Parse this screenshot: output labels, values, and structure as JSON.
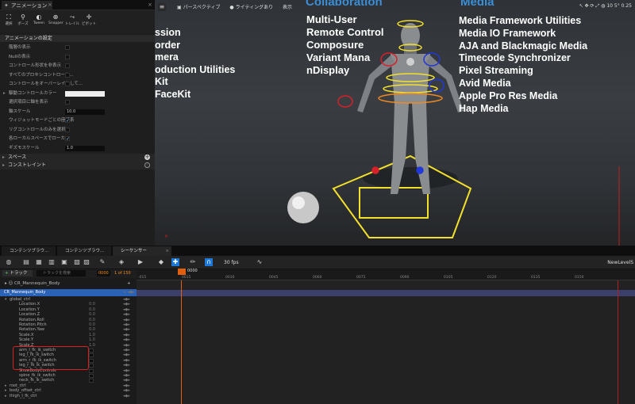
{
  "anim_panel": {
    "tab_label": "アニメーション",
    "tools": [
      "選択",
      "ポーズ",
      "Tween",
      "Snapper",
      "トレイル",
      "ピボット"
    ],
    "settings_title": "アニメーションの設定",
    "rows": [
      {
        "label": "階層の表示",
        "type": "check",
        "checked": false
      },
      {
        "label": "Nullの表示",
        "type": "check",
        "checked": false
      },
      {
        "label": "コントロール形状を非表示",
        "type": "check",
        "checked": false
      },
      {
        "label": "すべてのプロキシコントロール...",
        "type": "check",
        "checked": false
      },
      {
        "label": "コントロールをオーバーレイとして...",
        "type": "check",
        "checked": false
      },
      {
        "label": "駆動コントロールカラー",
        "type": "color"
      },
      {
        "label": "選択項目に軸を表示",
        "type": "check",
        "checked": false
      },
      {
        "label": "軸スケール",
        "type": "num",
        "value": "10.0"
      },
      {
        "label": "ウィジェットモードごとの座標系",
        "type": "check",
        "checked": true
      },
      {
        "label": "リグコントロールのみを選択",
        "type": "check",
        "checked": false
      },
      {
        "label": "各ローカルスペースでローカ...",
        "type": "check",
        "checked": true
      },
      {
        "label": "ギズモスケール",
        "type": "num",
        "value": "1.0"
      }
    ],
    "sections": [
      "スペース",
      "コンストレイント"
    ]
  },
  "viewport": {
    "toolbar": [
      "パースペクティブ",
      "ライティングあり",
      "表示"
    ],
    "right_vals": [
      "10",
      "5°",
      "0.25"
    ],
    "col1": [
      "ssion",
      "order",
      "mera",
      "oduction Utilities",
      "Kit",
      "FaceKit"
    ],
    "col2_head": "Collaboration",
    "col2": [
      "Multi-User",
      "Remote Control",
      "Composure",
      "Variant Mana",
      "nDisplay"
    ],
    "col3_head": "Media",
    "col3": [
      "Media Framework Utilities",
      "Media IO Framework",
      "AJA and Blackmagic Media",
      "Timecode Synchronizer",
      "Pixel Streaming",
      "Avid Media",
      "Apple Pro Res Media",
      "Hap Media"
    ]
  },
  "bottom_tabs": [
    "コンテンツブラウ...",
    "コンテンツブラウ...",
    "シーケンサー"
  ],
  "seq": {
    "fps": "30 fps",
    "level": "NewLevelS",
    "track_btn": "トラック",
    "search_ph": "トラックを検索",
    "frame": "0000",
    "frame_of": "1 of 150",
    "playhead": "0000",
    "ticks": [
      "-015",
      "0015",
      "0030",
      "0045",
      "0060",
      "0075",
      "0090",
      "0105",
      "0120",
      "0135",
      "0150"
    ],
    "root": "CR_Mannequin_Body",
    "rows": [
      {
        "t": "CR_Mannequin_Body",
        "sel": true,
        "d": 0
      },
      {
        "t": "global_ctrl",
        "d": 1
      },
      {
        "t": "Location.X",
        "v": "0.0",
        "d": 2
      },
      {
        "t": "Location.Y",
        "v": "0.0",
        "d": 2
      },
      {
        "t": "Location.Z",
        "v": "0.0",
        "d": 2
      },
      {
        "t": "Rotation.Roll",
        "v": "0.0",
        "d": 2
      },
      {
        "t": "Rotation.Pitch",
        "v": "0.0",
        "d": 2
      },
      {
        "t": "Rotation.Yaw",
        "v": "0.0",
        "d": 2
      },
      {
        "t": "Scale.X",
        "v": "1.0",
        "d": 2
      },
      {
        "t": "Scale.Y",
        "v": "1.0",
        "d": 2
      },
      {
        "t": "Scale.Z",
        "v": "1.0",
        "d": 2
      },
      {
        "t": "arm_l_fk_ik_switch",
        "d": 2
      },
      {
        "t": "leg_l_fk_ik_switch",
        "d": 2
      },
      {
        "t": "arm_r_fk_ik_switch",
        "d": 2
      },
      {
        "t": "leg_r_fk_ik_switch",
        "d": 2
      },
      {
        "t": "ShowBodyControls",
        "d": 2
      },
      {
        "t": "spine_fk_ik_switch",
        "d": 2
      },
      {
        "t": "neck_fk_ik_switch",
        "d": 2
      },
      {
        "t": "root_ctrl",
        "d": 1
      },
      {
        "t": "body_offset_ctrl",
        "d": 1
      },
      {
        "t": "thigh_l_fk_ctrl",
        "d": 1
      }
    ]
  }
}
